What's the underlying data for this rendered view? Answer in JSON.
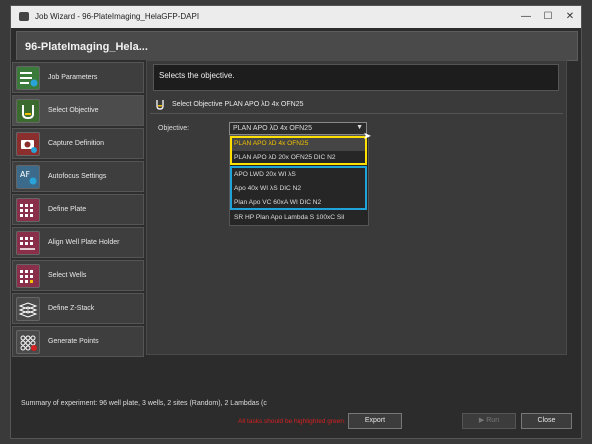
{
  "window": {
    "title": "Job Wizard - 96-PlateImaging_HelaGFP-DAPI",
    "controls": {
      "minimize": "—",
      "maximize": "☐",
      "close": "✕"
    }
  },
  "header": {
    "title": "96-PlateImaging_Hela..."
  },
  "sidebar": {
    "items": [
      {
        "label": "Job Parameters",
        "icon": "job-parameters-icon"
      },
      {
        "label": "Select Objective",
        "icon": "objective-icon"
      },
      {
        "label": "Capture Definition",
        "icon": "camera-icon"
      },
      {
        "label": "Autofocus Settings",
        "icon": "autofocus-icon"
      },
      {
        "label": "Define Plate",
        "icon": "plate-icon"
      },
      {
        "label": "Align Well Plate Holder",
        "icon": "align-plate-icon"
      },
      {
        "label": "Select Wells",
        "icon": "wells-icon"
      },
      {
        "label": "Define Z-Stack",
        "icon": "zstack-icon"
      },
      {
        "label": "Generate Points",
        "icon": "points-icon"
      }
    ],
    "active_index": 1
  },
  "main": {
    "description": "Selects the objective.",
    "section_title": "Select  Objective  PLAN  APO  λD  4x  OFN25",
    "objective_label": "Objective:",
    "objective_value": "PLAN APO λD 4x OFN25",
    "options": [
      "PLAN APO λD 4x OFN25",
      "PLAN APO λD 20x OFN25 DIC N2",
      "APO LWD 20x WI λS",
      "Apo 40x WI λS DIC N2",
      "Plan Apo VC 60xA WI DIC N2",
      "SR HP Plan Apo Lambda S 100xC Sil"
    ]
  },
  "footer": {
    "summary": "Summary of experiment: 96 well plate, 3 wells, 2 sites (Random), 2 Lambdas (c",
    "hint": "All tasks should be highlighted green.",
    "export_label": "Export",
    "run_label": "Run",
    "close_label": "Close"
  },
  "colors": {
    "yellow_highlight": "#ffe000",
    "blue_highlight": "#1ea4d8",
    "hint_red": "#d42020"
  }
}
